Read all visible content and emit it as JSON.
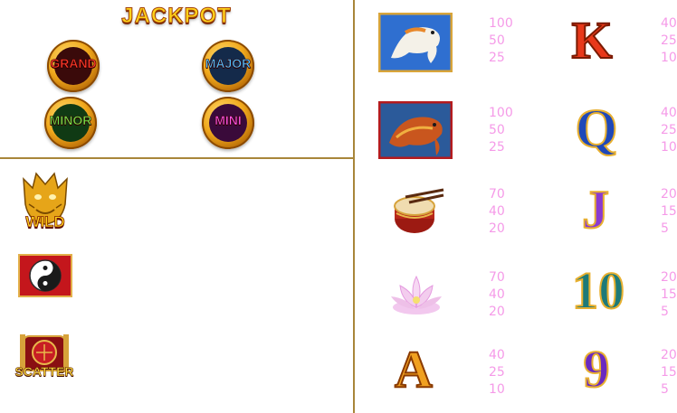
{
  "jackpot": {
    "title": "JACKPOT",
    "grand": "GRAND",
    "major": "MAJOR",
    "minor": "MINOR",
    "mini": "MINI"
  },
  "specials": {
    "wild_label": "WILD",
    "scatter_label": "SCATTER"
  },
  "paytable": [
    {
      "symbol": "koi-fish",
      "payouts": [
        "100",
        "50",
        "25"
      ]
    },
    {
      "symbol": "arowana-fish",
      "payouts": [
        "100",
        "50",
        "25"
      ]
    },
    {
      "symbol": "drum",
      "payouts": [
        "70",
        "40",
        "20"
      ]
    },
    {
      "symbol": "lotus",
      "payouts": [
        "70",
        "40",
        "20"
      ]
    },
    {
      "symbol": "A",
      "payouts": [
        "40",
        "25",
        "10"
      ]
    },
    {
      "symbol": "K",
      "payouts": [
        "40",
        "25",
        "10"
      ]
    },
    {
      "symbol": "Q",
      "payouts": [
        "40",
        "25",
        "10"
      ]
    },
    {
      "symbol": "J",
      "payouts": [
        "20",
        "15",
        "5"
      ]
    },
    {
      "symbol": "10",
      "payouts": [
        "20",
        "15",
        "5"
      ]
    },
    {
      "symbol": "9",
      "payouts": [
        "20",
        "15",
        "5"
      ]
    }
  ],
  "colors": {
    "divider": "#a8863a",
    "payout_text": "#f59ae8",
    "grand": "#e0221a",
    "major": "#2ea9f0",
    "minor": "#4fd13a",
    "mini": "#e83ee0"
  }
}
